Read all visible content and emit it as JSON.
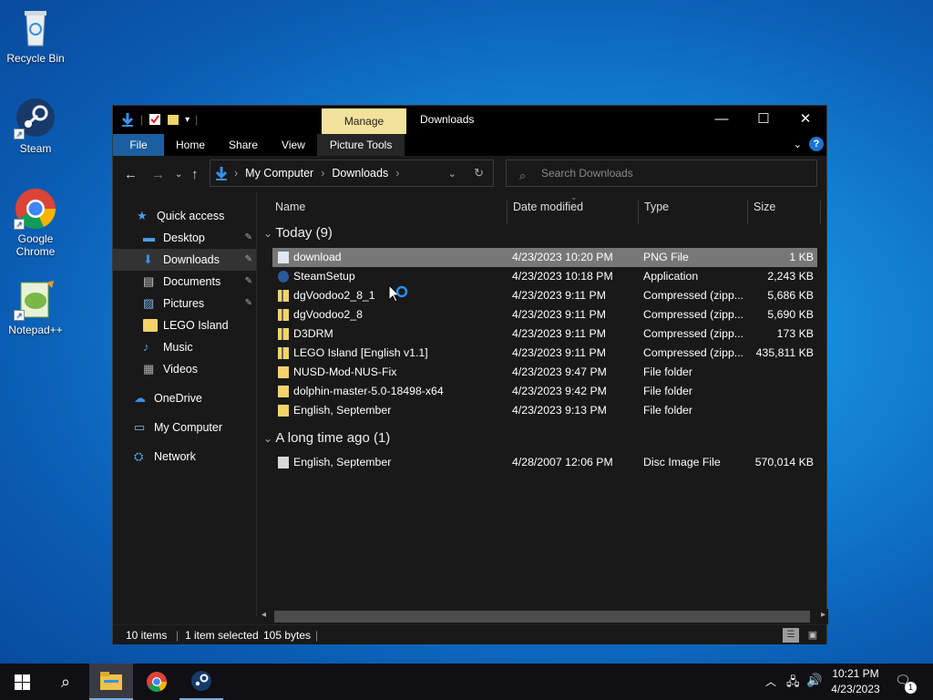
{
  "desktop": {
    "icons": [
      {
        "label": "Recycle Bin"
      },
      {
        "label": "Steam"
      },
      {
        "label": "Google Chrome"
      },
      {
        "label": "Notepad++"
      }
    ]
  },
  "window": {
    "title": "Downloads",
    "manage_label": "Manage",
    "ribbon": {
      "tabs": [
        "File",
        "Home",
        "Share",
        "View",
        "Picture Tools"
      ]
    },
    "address": {
      "crumbs": [
        "My Computer",
        "Downloads"
      ]
    },
    "search": {
      "placeholder": "Search Downloads"
    },
    "nav": [
      {
        "label": "Quick access",
        "icon": "star-icon"
      },
      {
        "label": "Desktop",
        "icon": "desktop-icon",
        "pinned": true
      },
      {
        "label": "Downloads",
        "icon": "download-icon",
        "pinned": true,
        "selected": true
      },
      {
        "label": "Documents",
        "icon": "documents-icon",
        "pinned": true
      },
      {
        "label": "Pictures",
        "icon": "pictures-icon",
        "pinned": true
      },
      {
        "label": "LEGO Island",
        "icon": "folder-icon"
      },
      {
        "label": "Music",
        "icon": "music-icon"
      },
      {
        "label": "Videos",
        "icon": "videos-icon"
      },
      {
        "label": "OneDrive",
        "icon": "cloud-icon"
      },
      {
        "label": "My Computer",
        "icon": "computer-icon"
      },
      {
        "label": "Network",
        "icon": "network-icon"
      }
    ],
    "columns": [
      "Name",
      "Date modified",
      "Type",
      "Size"
    ],
    "groups": [
      {
        "label": "Today (9)",
        "files": [
          {
            "name": "download",
            "date": "4/23/2023 10:20 PM",
            "type": "PNG File",
            "size": "1 KB",
            "icon": "image-file-icon",
            "selected": true
          },
          {
            "name": "SteamSetup",
            "date": "4/23/2023 10:18 PM",
            "type": "Application",
            "size": "2,243 KB",
            "icon": "steam-icon"
          },
          {
            "name": "dgVoodoo2_8_1",
            "date": "4/23/2023 9:11 PM",
            "type": "Compressed (zipp...",
            "size": "5,686 KB",
            "icon": "zip-folder-icon"
          },
          {
            "name": "dgVoodoo2_8",
            "date": "4/23/2023 9:11 PM",
            "type": "Compressed (zipp...",
            "size": "5,690 KB",
            "icon": "zip-folder-icon"
          },
          {
            "name": "D3DRM",
            "date": "4/23/2023 9:11 PM",
            "type": "Compressed (zipp...",
            "size": "173 KB",
            "icon": "zip-folder-icon"
          },
          {
            "name": "LEGO Island [English v1.1]",
            "date": "4/23/2023 9:11 PM",
            "type": "Compressed (zipp...",
            "size": "435,811 KB",
            "icon": "zip-folder-icon"
          },
          {
            "name": "NUSD-Mod-NUS-Fix",
            "date": "4/23/2023 9:47 PM",
            "type": "File folder",
            "size": "",
            "icon": "folder-icon"
          },
          {
            "name": "dolphin-master-5.0-18498-x64",
            "date": "4/23/2023 9:42 PM",
            "type": "File folder",
            "size": "",
            "icon": "folder-icon"
          },
          {
            "name": "English, September",
            "date": "4/23/2023 9:13 PM",
            "type": "File folder",
            "size": "",
            "icon": "folder-icon"
          }
        ]
      },
      {
        "label": "A long time ago (1)",
        "files": [
          {
            "name": "English, September",
            "date": "4/28/2007 12:06 PM",
            "type": "Disc Image File",
            "size": "570,014 KB",
            "icon": "disc-image-icon"
          }
        ]
      }
    ],
    "status": {
      "items": "10 items",
      "selected": "1 item selected",
      "size": "105 bytes"
    }
  },
  "taskbar": {
    "time": "10:21 PM",
    "date": "4/23/2023",
    "notifications": "1"
  }
}
